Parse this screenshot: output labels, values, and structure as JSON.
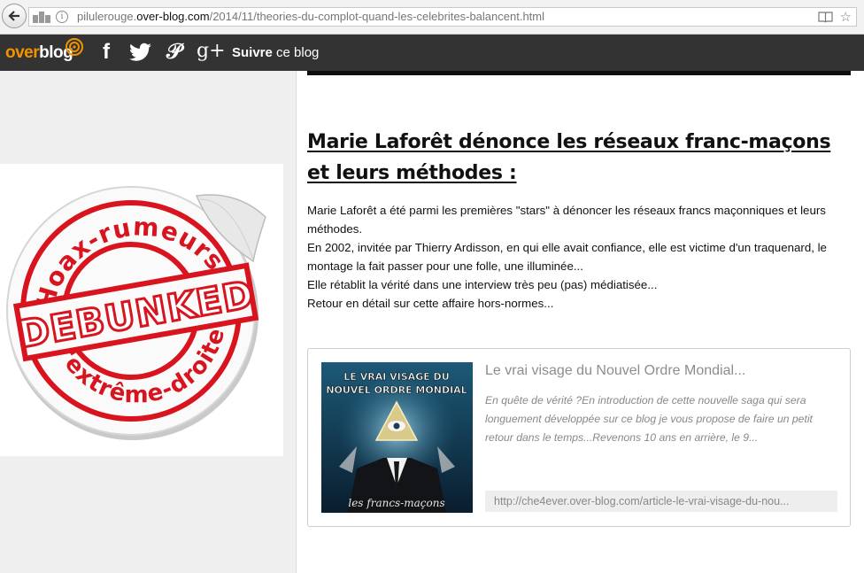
{
  "browser": {
    "url_prefix": "pilulerouge.",
    "url_domain": "over-blog.com",
    "url_path": "/2014/11/theories-du-complot-quand-les-celebrites-balancent.html"
  },
  "blog_bar": {
    "logo_part1": "over",
    "logo_part2": "blog",
    "follow_bold": "Suivre",
    "follow_rest": " ce blog"
  },
  "left": {
    "badge_text_top": "Hoax-rumeurs",
    "badge_text_center": "DEBUNKED",
    "badge_text_bottom": "d'extrême-droite"
  },
  "article": {
    "title": "Marie Laforêt dénonce les réseaux franc-maçons et leurs méthodes :",
    "paragraphs": [
      "Marie Laforêt a été parmi les premières \"stars\" à dénoncer les réseaux francs maçonniques et leurs méthodes.",
      "En 2002, invitée par Thierry Ardisson, en qui elle avait confiance, elle est victime d'un traquenard, le montage la fait passer pour une folle, une illuminée...",
      "Elle rétablit la vérité dans une interview très peu (pas) médiatisée...",
      "Retour en détail sur cette affaire hors-normes..."
    ]
  },
  "link_preview": {
    "thumb_line1": "LE VRAI VISAGE DU",
    "thumb_line2": "NOUVEL ORDRE MONDIAL",
    "thumb_caption": "les francs-maçons",
    "title": "Le vrai visage du Nouvel Ordre Mondial...",
    "description": "En quête de vérité ?En introduction de cette nouvelle saga qui sera longuement développée sur ce blog je vous propose de faire un petit retour dans le temps...Revenons 10 ans en arrière, le 9...",
    "url": "http://che4ever.over-blog.com/article-le-vrai-visage-du-nou..."
  },
  "colors": {
    "brand_orange": "#f39200",
    "bar_bg": "#333333",
    "stamp_red": "#d8141e"
  }
}
